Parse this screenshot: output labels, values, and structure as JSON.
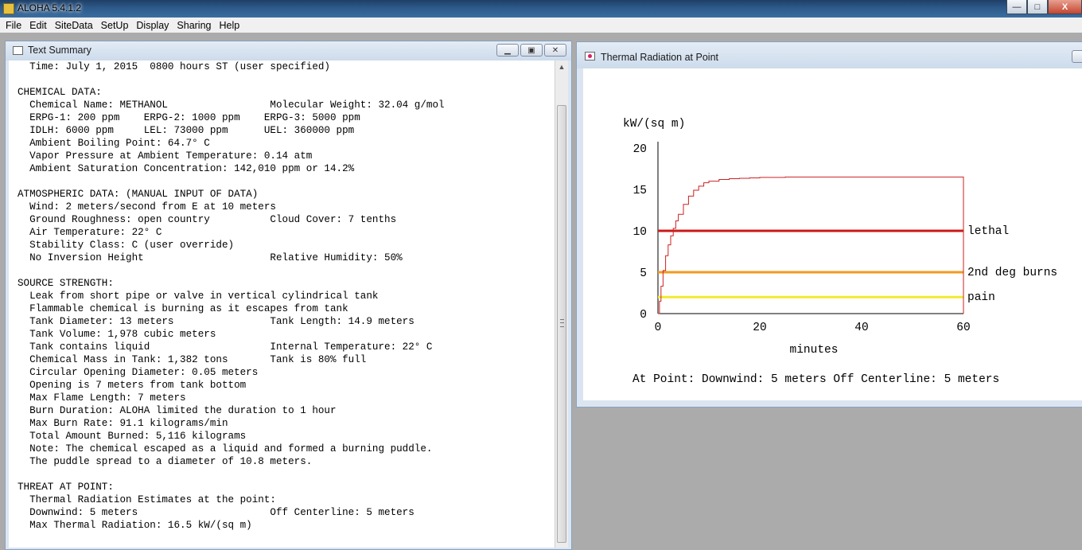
{
  "app": {
    "title": "ALOHA 5.4.1.2",
    "window_buttons": {
      "minimize": "—",
      "maximize": "□",
      "close": "X"
    }
  },
  "menu": [
    "File",
    "Edit",
    "SiteData",
    "SetUp",
    "Display",
    "Sharing",
    "Help"
  ],
  "text_summary": {
    "title": "Text Summary",
    "lines": [
      "  Time: July 1, 2015  0800 hours ST (user specified)",
      "",
      "CHEMICAL DATA:",
      "  Chemical Name: METHANOL                 Molecular Weight: 32.04 g/mol",
      "  ERPG-1: 200 ppm    ERPG-2: 1000 ppm    ERPG-3: 5000 ppm",
      "  IDLH: 6000 ppm     LEL: 73000 ppm      UEL: 360000 ppm",
      "  Ambient Boiling Point: 64.7° C",
      "  Vapor Pressure at Ambient Temperature: 0.14 atm",
      "  Ambient Saturation Concentration: 142,010 ppm or 14.2%",
      "",
      "ATMOSPHERIC DATA: (MANUAL INPUT OF DATA)",
      "  Wind: 2 meters/second from E at 10 meters",
      "  Ground Roughness: open country          Cloud Cover: 7 tenths",
      "  Air Temperature: 22° C",
      "  Stability Class: C (user override)",
      "  No Inversion Height                     Relative Humidity: 50%",
      "",
      "SOURCE STRENGTH:",
      "  Leak from short pipe or valve in vertical cylindrical tank",
      "  Flammable chemical is burning as it escapes from tank",
      "  Tank Diameter: 13 meters                Tank Length: 14.9 meters",
      "  Tank Volume: 1,978 cubic meters",
      "  Tank contains liquid                    Internal Temperature: 22° C",
      "  Chemical Mass in Tank: 1,382 tons       Tank is 80% full",
      "  Circular Opening Diameter: 0.05 meters",
      "  Opening is 7 meters from tank bottom",
      "  Max Flame Length: 7 meters",
      "  Burn Duration: ALOHA limited the duration to 1 hour",
      "  Max Burn Rate: 91.1 kilograms/min",
      "  Total Amount Burned: 5,116 kilograms",
      "  Note: The chemical escaped as a liquid and formed a burning puddle.",
      "  The puddle spread to a diameter of 10.8 meters.",
      "",
      "THREAT AT POINT:",
      "  Thermal Radiation Estimates at the point:",
      "  Downwind: 5 meters                      Off Centerline: 5 meters",
      "  Max Thermal Radiation: 16.5 kW/(sq m)"
    ]
  },
  "thermal_window": {
    "title": "Thermal Radiation at Point",
    "at_point_line": "At Point:   Downwind: 5 meters   Off Centerline: 5 meters"
  },
  "chart_data": {
    "type": "line",
    "title": "",
    "ylabel": "kW/(sq m)",
    "xlabel": "minutes",
    "xlim": [
      0,
      60
    ],
    "ylim": [
      0,
      20
    ],
    "x_ticks": [
      0,
      20,
      40,
      60
    ],
    "y_ticks": [
      0,
      5,
      10,
      15,
      20
    ],
    "grid": false,
    "series": [
      {
        "color": "#cc2222",
        "x": [
          0,
          0.3,
          0.6,
          1,
          1.5,
          2,
          2.5,
          3,
          3.5,
          4,
          5,
          6,
          7,
          8,
          9,
          10,
          12,
          14,
          16,
          18,
          20,
          25,
          30,
          40,
          50,
          60
        ],
        "y": [
          0,
          1.5,
          3.3,
          5.2,
          7.0,
          8.3,
          9.4,
          10.3,
          11.2,
          12.0,
          13.2,
          14.2,
          14.9,
          15.4,
          15.8,
          16.0,
          16.2,
          16.3,
          16.35,
          16.4,
          16.45,
          16.5,
          16.5,
          16.5,
          16.5,
          16.5
        ]
      }
    ],
    "thresholds": [
      {
        "label": "lethal",
        "value": 10,
        "color": "#cc1a1a"
      },
      {
        "label": "2nd deg burns",
        "value": 5,
        "color": "#f29a1d"
      },
      {
        "label": "pain",
        "value": 2,
        "color": "#f2ea30"
      }
    ]
  }
}
